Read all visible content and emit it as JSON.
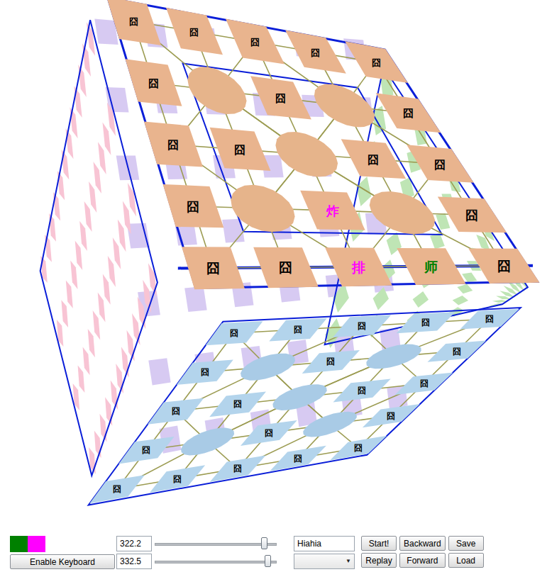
{
  "board": {
    "top_face": [
      [
        {
          "kind": "post",
          "piece": "囧",
          "color": "#000000"
        },
        {
          "kind": "post",
          "piece": "囧",
          "color": "#000000"
        },
        {
          "kind": "post",
          "piece": "囧",
          "color": "#000000"
        },
        {
          "kind": "post",
          "piece": "囧",
          "color": "#000000"
        },
        {
          "kind": "post",
          "piece": "囧",
          "color": "#000000"
        }
      ],
      [
        {
          "kind": "post",
          "piece": "囧",
          "color": "#000000"
        },
        {
          "kind": "camp",
          "piece": "",
          "color": "#000000"
        },
        {
          "kind": "post",
          "piece": "囧",
          "color": "#000000"
        },
        {
          "kind": "camp",
          "piece": "",
          "color": "#000000"
        },
        {
          "kind": "post",
          "piece": "囧",
          "color": "#000000"
        }
      ],
      [
        {
          "kind": "post",
          "piece": "囧",
          "color": "#000000"
        },
        {
          "kind": "post",
          "piece": "囧",
          "color": "#000000"
        },
        {
          "kind": "camp",
          "piece": "",
          "color": "#000000"
        },
        {
          "kind": "post",
          "piece": "囧",
          "color": "#000000"
        },
        {
          "kind": "post",
          "piece": "囧",
          "color": "#000000"
        }
      ],
      [
        {
          "kind": "post",
          "piece": "囧",
          "color": "#000000"
        },
        {
          "kind": "camp",
          "piece": "",
          "color": "#000000"
        },
        {
          "kind": "post",
          "piece": "炸",
          "color": "#ff00ff"
        },
        {
          "kind": "camp",
          "piece": "",
          "color": "#000000"
        },
        {
          "kind": "post",
          "piece": "囧",
          "color": "#000000"
        }
      ],
      [
        {
          "kind": "post",
          "piece": "囧",
          "color": "#000000"
        },
        {
          "kind": "post",
          "piece": "囧",
          "color": "#000000"
        },
        {
          "kind": "post",
          "piece": "排",
          "color": "#ff00ff"
        },
        {
          "kind": "post",
          "piece": "师",
          "color": "#008000"
        },
        {
          "kind": "post",
          "piece": "囧",
          "color": "#000000"
        }
      ]
    ],
    "front_face": [
      [
        {
          "kind": "post",
          "piece": "囧",
          "color": "#000000"
        },
        {
          "kind": "post",
          "piece": "囧",
          "color": "#000000"
        },
        {
          "kind": "post",
          "piece": "囧",
          "color": "#000000"
        },
        {
          "kind": "post",
          "piece": "囧",
          "color": "#000000"
        },
        {
          "kind": "post",
          "piece": "囧",
          "color": "#000000"
        }
      ],
      [
        {
          "kind": "post",
          "piece": "囧",
          "color": "#000000"
        },
        {
          "kind": "camp",
          "piece": "",
          "color": "#000000"
        },
        {
          "kind": "post",
          "piece": "囧",
          "color": "#000000"
        },
        {
          "kind": "camp",
          "piece": "",
          "color": "#000000"
        },
        {
          "kind": "post",
          "piece": "囧",
          "color": "#000000"
        }
      ],
      [
        {
          "kind": "post",
          "piece": "囧",
          "color": "#000000"
        },
        {
          "kind": "post",
          "piece": "囧",
          "color": "#000000"
        },
        {
          "kind": "camp",
          "piece": "",
          "color": "#000000"
        },
        {
          "kind": "post",
          "piece": "囧",
          "color": "#000000"
        },
        {
          "kind": "post",
          "piece": "囧",
          "color": "#000000"
        }
      ],
      [
        {
          "kind": "post",
          "piece": "囧",
          "color": "#000000"
        },
        {
          "kind": "camp",
          "piece": "",
          "color": "#000000"
        },
        {
          "kind": "post",
          "piece": "囧",
          "color": "#000000"
        },
        {
          "kind": "camp",
          "piece": "",
          "color": "#000000"
        },
        {
          "kind": "post",
          "piece": "囧",
          "color": "#000000"
        }
      ],
      [
        {
          "kind": "post",
          "piece": "囧",
          "color": "#000000"
        },
        {
          "kind": "post",
          "piece": "囧",
          "color": "#000000"
        },
        {
          "kind": "post",
          "piece": "囧",
          "color": "#000000"
        },
        {
          "kind": "post",
          "piece": "囧",
          "color": "#000000"
        },
        {
          "kind": "post",
          "piece": "囧",
          "color": "#000000"
        }
      ]
    ]
  },
  "players": [
    {
      "color": "#008000"
    },
    {
      "color": "#ff00ff"
    }
  ],
  "controls": {
    "keyboard_button": "Enable Keyboard",
    "coords": [
      {
        "value": "322.2",
        "level": 0.9
      },
      {
        "value": "332.5",
        "level": 0.93
      }
    ],
    "name_field": {
      "value": "Hiahia"
    },
    "dropdown": {
      "value": "",
      "arrow": "▼"
    },
    "buttons": [
      "Start!",
      "Backward",
      "Save",
      "Replay",
      "Forward",
      "Load"
    ]
  }
}
